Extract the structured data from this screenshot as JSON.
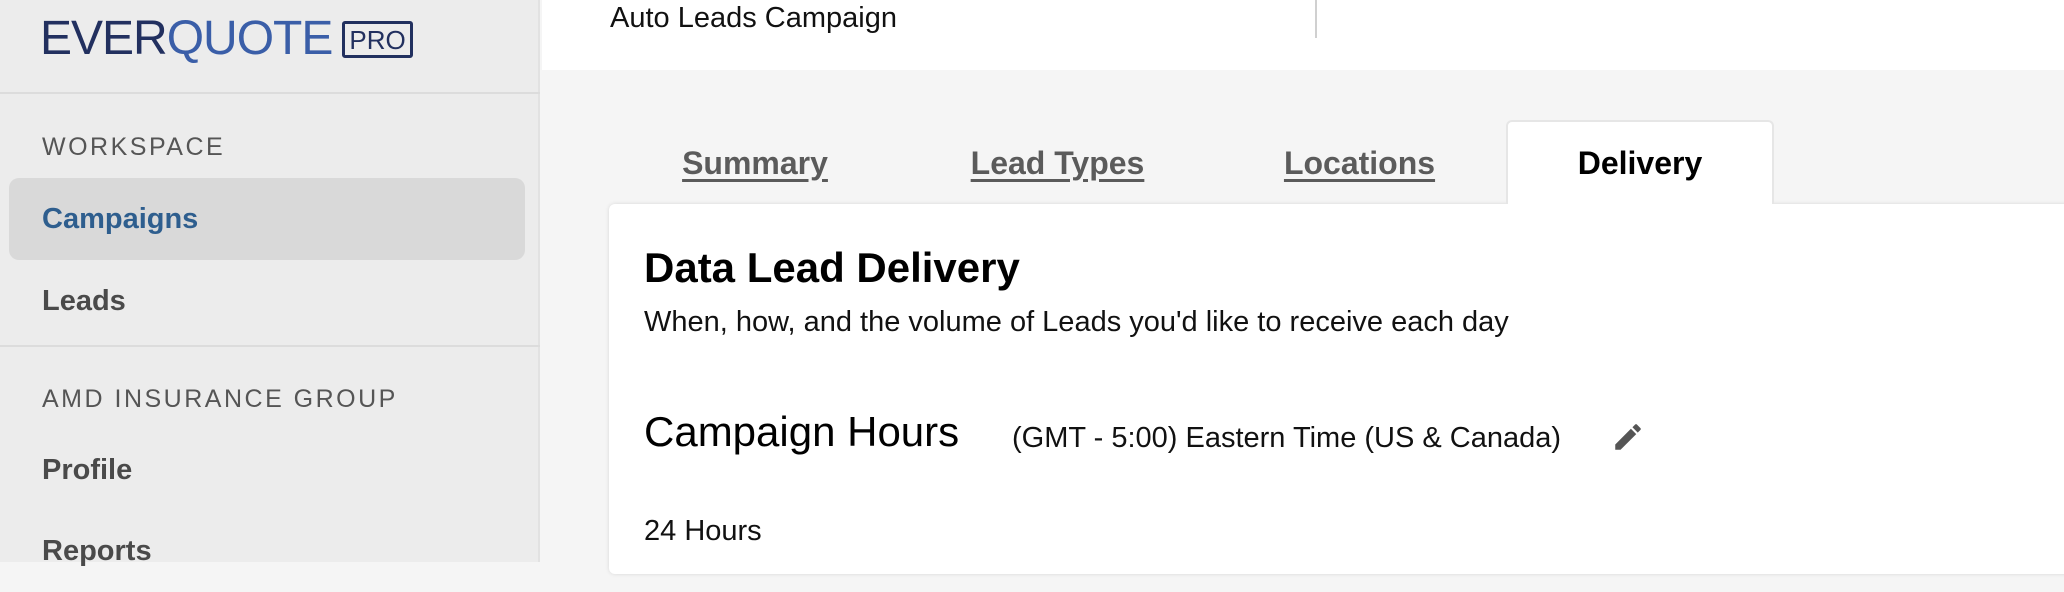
{
  "logo": {
    "ever": "EVER",
    "quote": "QUOTE",
    "badge": "PRO"
  },
  "sidebar": {
    "workspace_label": "WORKSPACE",
    "workspace_items": [
      {
        "label": "Campaigns",
        "active": true
      },
      {
        "label": "Leads",
        "active": false
      }
    ],
    "org_label": "AMD INSURANCE GROUP",
    "org_items": [
      {
        "label": "Profile"
      },
      {
        "label": "Reports"
      }
    ]
  },
  "header": {
    "campaign_name": "Auto Leads Campaign"
  },
  "tabs": [
    {
      "label": "Summary",
      "active": false
    },
    {
      "label": "Lead Types",
      "active": false
    },
    {
      "label": "Locations",
      "active": false
    },
    {
      "label": "Delivery",
      "active": true
    }
  ],
  "delivery": {
    "title": "Data Lead Delivery",
    "subtitle": "When, how, and the volume of Leads you'd like to receive each day",
    "campaign_hours": {
      "heading": "Campaign Hours",
      "timezone": "(GMT - 5:00) Eastern Time (US & Canada)",
      "edit_icon": "pencil-icon",
      "value": "24 Hours"
    }
  },
  "colors": {
    "active_nav_text": "#2e5e8e",
    "active_nav_bg": "#d9d9d9",
    "logo_dark": "#22305f",
    "logo_light": "#3a5ea8"
  }
}
